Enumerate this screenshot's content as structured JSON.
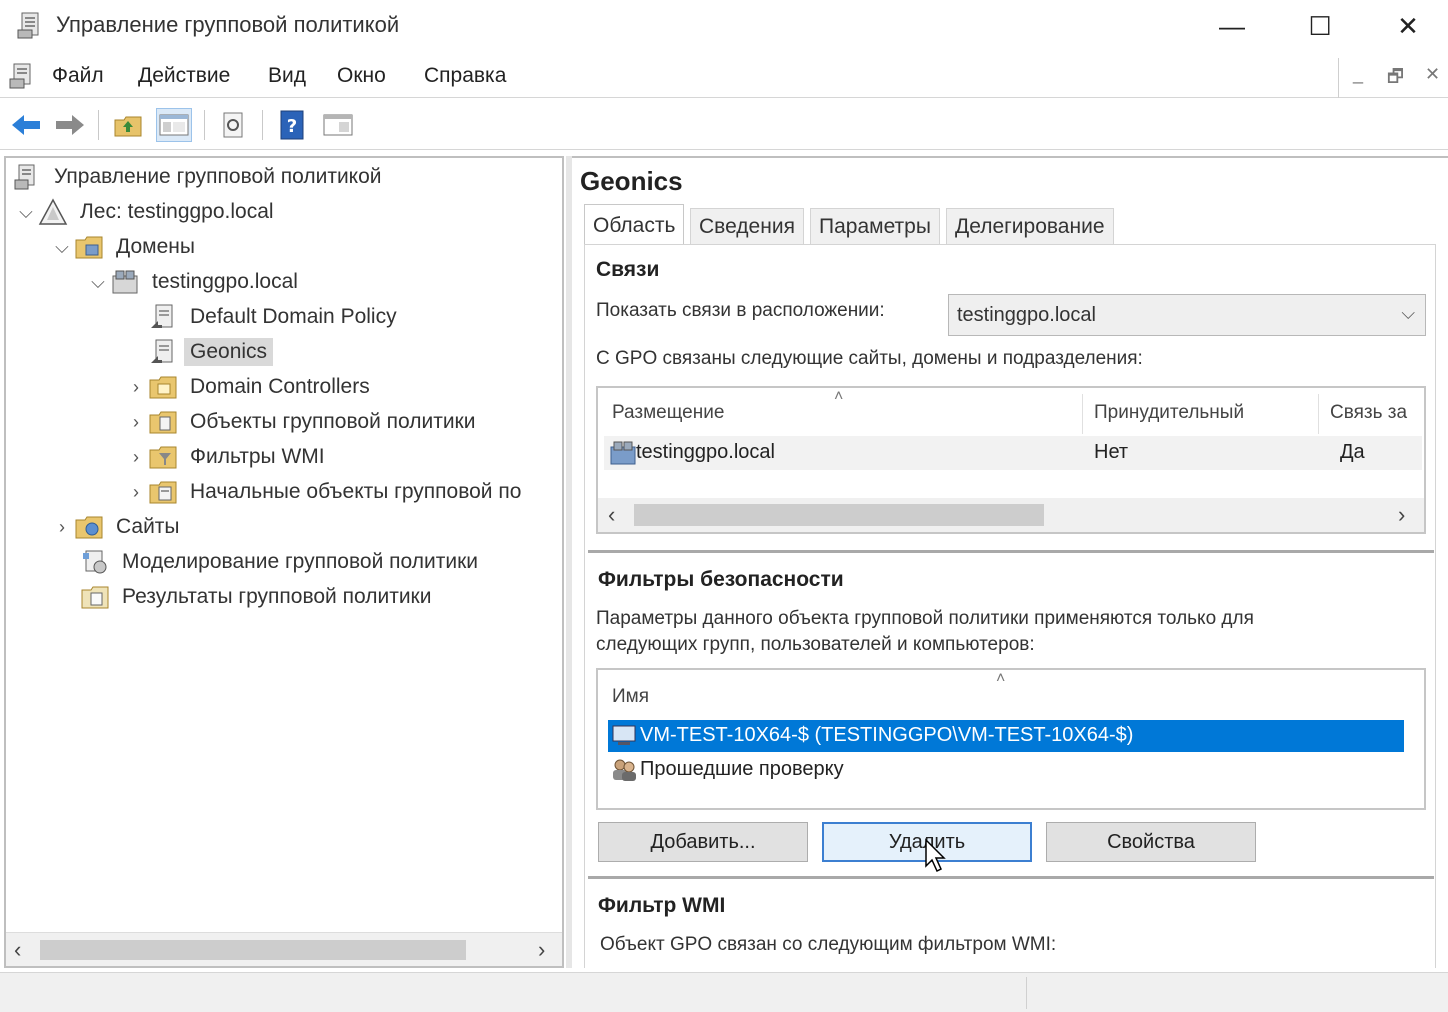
{
  "window": {
    "title": "Управление групповой политикой",
    "controls": {
      "minimize": "—",
      "maximize": "☐",
      "close": "✕"
    }
  },
  "menu": [
    "Файл",
    "Действие",
    "Вид",
    "Окно",
    "Справка"
  ],
  "mdi_controls": {
    "minimize": "_",
    "restore": "🗗",
    "close": "✕"
  },
  "toolbar": {
    "icons": [
      "back-arrow-icon",
      "forward-arrow-icon",
      "up-folder-icon",
      "show-hide-tree-icon",
      "refresh-icon",
      "help-icon",
      "properties-icon"
    ]
  },
  "tree": {
    "root": "Управление групповой политикой",
    "forest": "Лес: testinggpo.local",
    "domains": "Домены",
    "domain": "testinggpo.local",
    "items": [
      "Default Domain Policy",
      "Geonics",
      "Domain Controllers",
      "Объекты групповой политики",
      "Фильтры WMI",
      "Начальные объекты групповой по"
    ],
    "sites": "Сайты",
    "modeling": "Моделирование групповой политики",
    "results": "Результаты групповой политики"
  },
  "right": {
    "gpo_name": "Geonics",
    "tabs": [
      "Область",
      "Сведения",
      "Параметры",
      "Делегирование"
    ],
    "active_tab": "Область",
    "links": {
      "title": "Связи",
      "show_label": "Показать связи в расположении:",
      "location_value": "testinggpo.local",
      "description": "С GPO связаны следующие сайты, домены и подразделения:",
      "columns": [
        "Размещение",
        "Принудительный",
        "Связь за"
      ],
      "rows": [
        {
          "location": "testinggpo.local",
          "enforced": "Нет",
          "link_enabled": "Да"
        }
      ]
    },
    "security": {
      "title": "Фильтры безопасности",
      "description_line1": "Параметры данного объекта групповой политики применяются только для",
      "description_line2": "следующих групп, пользователей и компьютеров:",
      "column": "Имя",
      "rows": [
        "VM-TEST-10X64-$ (TESTINGGPO\\VM-TEST-10X64-$)",
        "Прошедшие проверку"
      ],
      "buttons": {
        "add": "Добавить...",
        "remove": "Удалить",
        "properties": "Свойства"
      }
    },
    "wmi": {
      "title": "Фильтр WMI",
      "description": "Объект GPO связан со следующим фильтром WMI:"
    }
  },
  "colors": {
    "selection": "#0078d7",
    "tree_selected": "#d9d9d9",
    "button_focus_border": "#3c7fd1"
  }
}
